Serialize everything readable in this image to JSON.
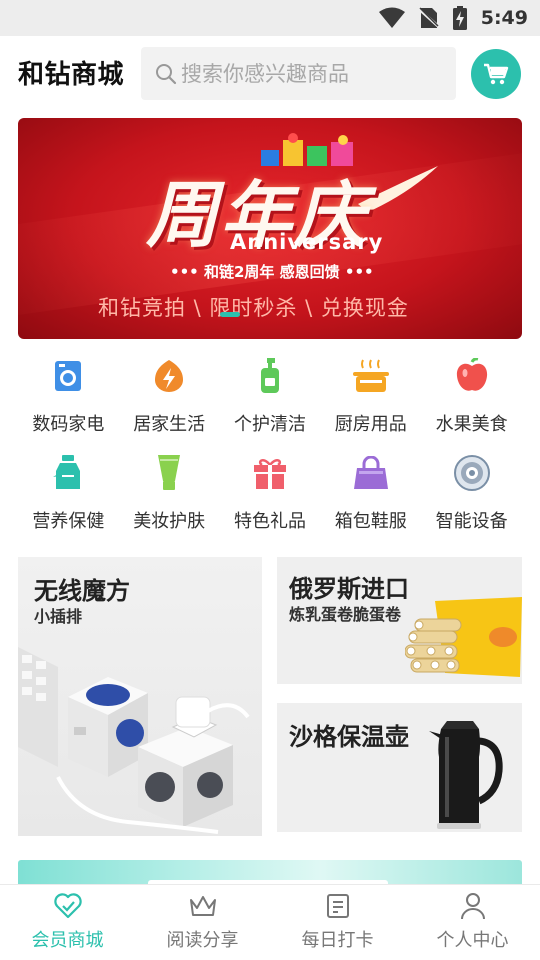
{
  "status_bar": {
    "time": "5:49",
    "icons": [
      "wifi-icon",
      "no-sim-icon",
      "battery-charging-icon"
    ]
  },
  "header": {
    "brand": "和钻商城",
    "search_placeholder": "搜索你感兴趣商品",
    "cart_icon": "cart-icon",
    "accent_color": "#2cc0ad"
  },
  "banner": {
    "title": "周年庆",
    "english": "Anniversary",
    "subtitle": "••• 和链2周年 感恩回馈 •••",
    "tagline": "和钻竞拍 \\ 限时秒杀 \\ 兑换现金",
    "background_color": "#d21c22"
  },
  "categories": [
    {
      "label": "数码家电",
      "icon": "washing-machine-icon",
      "color": "#3f8fe6"
    },
    {
      "label": "居家生活",
      "icon": "lightning-bolt-icon",
      "color": "#f08a2b"
    },
    {
      "label": "个护清洁",
      "icon": "lotion-bottle-icon",
      "color": "#5ec95a"
    },
    {
      "label": "厨房用品",
      "icon": "cooking-pot-icon",
      "color": "#f5a623"
    },
    {
      "label": "水果美食",
      "icon": "apple-icon",
      "color": "#f0514c"
    },
    {
      "label": "营养保健",
      "icon": "supplement-bottle-icon",
      "color": "#2cc0ad"
    },
    {
      "label": "美妆护肤",
      "icon": "cosmetic-tube-icon",
      "color": "#8ad14e"
    },
    {
      "label": "特色礼品",
      "icon": "gift-box-icon",
      "color": "#f05f6b"
    },
    {
      "label": "箱包鞋服",
      "icon": "handbag-icon",
      "color": "#9b6cd6"
    },
    {
      "label": "智能设备",
      "icon": "robot-vacuum-icon",
      "color": "#7a8fa6"
    }
  ],
  "promos": {
    "left": {
      "title": "无线魔方",
      "subtitle": "小插排"
    },
    "right_top": {
      "title": "俄罗斯进口",
      "subtitle": "炼乳蛋卷脆蛋卷"
    },
    "right_bottom": {
      "title": "沙格保温壶",
      "subtitle": ""
    }
  },
  "bottom_nav": [
    {
      "label": "会员商城",
      "icon": "heart-check-icon",
      "active": true
    },
    {
      "label": "阅读分享",
      "icon": "crown-icon",
      "active": false
    },
    {
      "label": "每日打卡",
      "icon": "notepad-icon",
      "active": false
    },
    {
      "label": "个人中心",
      "icon": "person-icon",
      "active": false
    }
  ]
}
